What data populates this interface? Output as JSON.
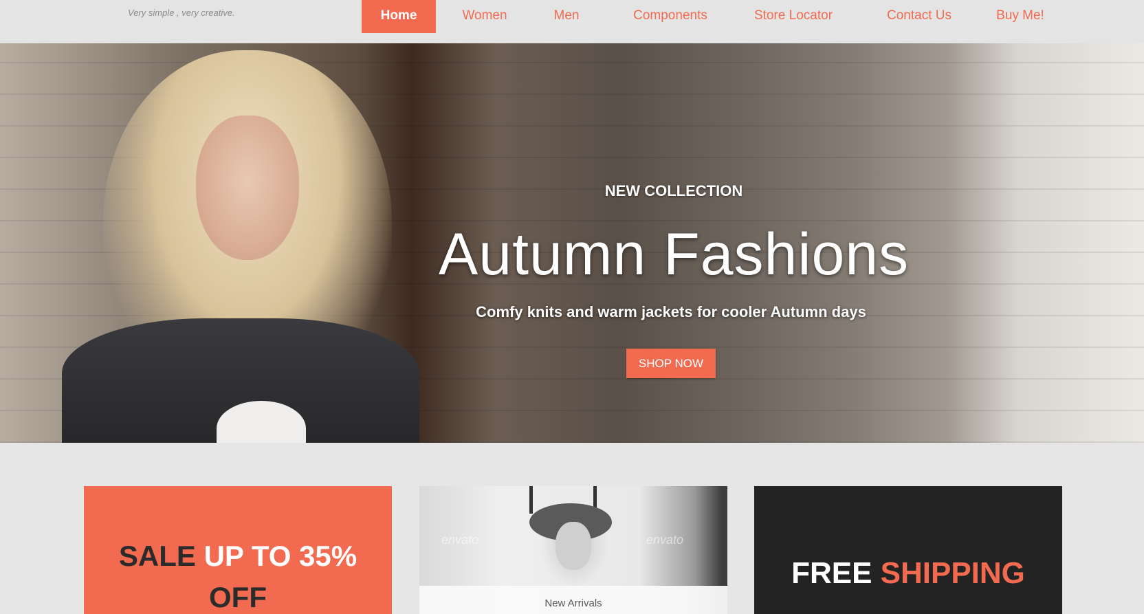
{
  "header": {
    "tagline": "Very simple , very creative."
  },
  "nav": {
    "items": [
      {
        "label": "Home",
        "active": true
      },
      {
        "label": "Women"
      },
      {
        "label": "Men"
      },
      {
        "label": "Components"
      },
      {
        "label": "Store Locator"
      },
      {
        "label": "Contact Us"
      },
      {
        "label": "Buy Me!"
      }
    ]
  },
  "hero": {
    "eyebrow": "NEW COLLECTION",
    "title": "Autumn Fashions",
    "subtitle": "Comfy knits and warm jackets for cooler Autumn days",
    "cta": "SHOP NOW",
    "next_icon": "chevron-right-icon"
  },
  "promos": {
    "sale": {
      "part1": "SALE ",
      "part2": "UP TO 35%",
      "part3": "OFF"
    },
    "arrivals": {
      "label": "New Arrivals",
      "watermark": "envato"
    },
    "shipping": {
      "part1": "FREE ",
      "part2": "SHIPPING"
    }
  },
  "colors": {
    "accent": "#f26b50",
    "dark": "#232323",
    "background": "#e6e6e6"
  }
}
